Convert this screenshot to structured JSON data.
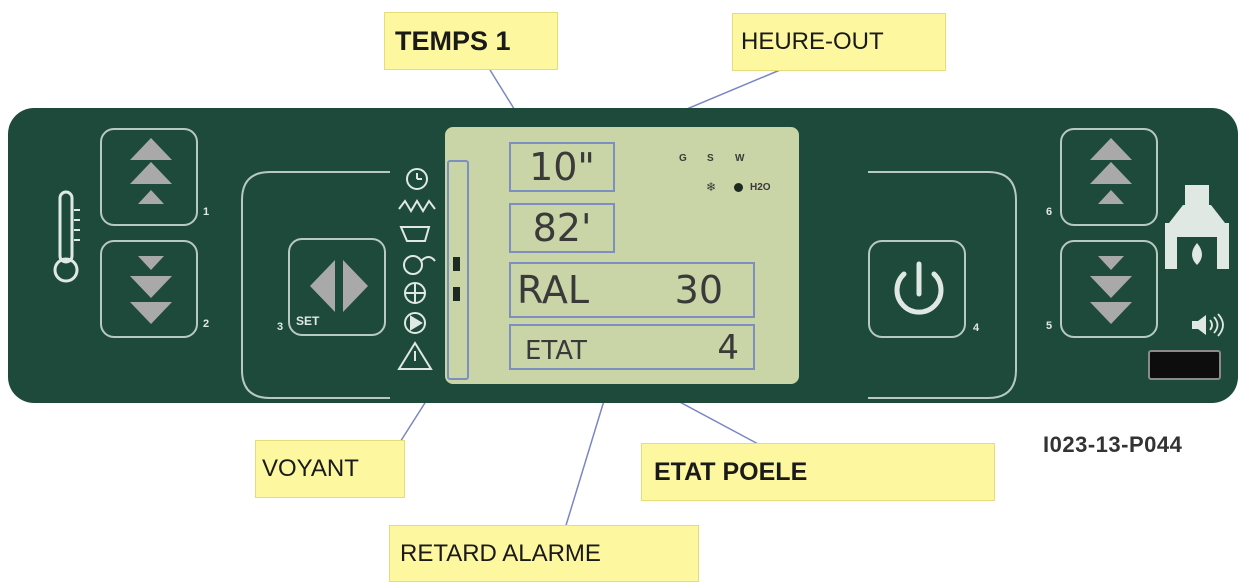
{
  "display": {
    "time_value": "10\"",
    "hour_value": "82'",
    "ral_label": "RAL",
    "ral_value": "30",
    "state_label": "ETAT",
    "state_value": "4",
    "indicators_top": [
      "G",
      "S",
      "W"
    ],
    "h2o_label": "H2O"
  },
  "callouts": {
    "temps1": "TEMPS 1",
    "heure_out": "HEURE-OUT",
    "voyant": "VOYANT",
    "etat_poele": "ETAT POELE",
    "retard_alarme": "RETARD ALARME"
  },
  "buttons": {
    "b1": "1",
    "b2": "2",
    "b3": "3",
    "b4": "4",
    "b5": "5",
    "b6": "6",
    "set_label": "SET"
  },
  "reference_code": "I023-13-P044",
  "colors": {
    "panel": "#1e4a3c",
    "lcd": "#c9d4a7",
    "callout": "#fdf7a0",
    "button_grey": "#a9a9a9"
  }
}
